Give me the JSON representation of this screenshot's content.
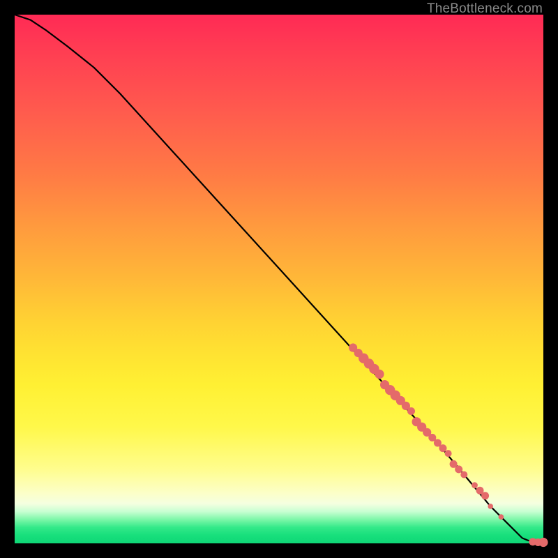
{
  "watermark": "TheBottleneck.com",
  "colors": {
    "background": "#000000",
    "curve": "#000000",
    "dot": "#e46a6a",
    "gradient_stops": [
      "#ff2a55",
      "#ff7a45",
      "#ffd233",
      "#fffd8e",
      "#17df7c"
    ]
  },
  "chart_data": {
    "type": "line",
    "title": "",
    "xlabel": "",
    "ylabel": "",
    "xlim": [
      0,
      100
    ],
    "ylim": [
      0,
      100
    ],
    "grid": false,
    "legend": false,
    "annotations": [
      "TheBottleneck.com"
    ],
    "series": [
      {
        "name": "bottleneck-curve",
        "x": [
          0,
          3,
          6,
          10,
          15,
          20,
          30,
          40,
          50,
          60,
          70,
          80,
          85,
          90,
          93,
          96,
          97,
          98,
          99,
          100
        ],
        "y": [
          100,
          99,
          97,
          94,
          90,
          85,
          74,
          63,
          52,
          41,
          30,
          19,
          13,
          7,
          4,
          1,
          0.6,
          0.3,
          0.2,
          0.2
        ]
      }
    ],
    "scatter_points": [
      {
        "x": 64,
        "y": 37,
        "r": 1.1
      },
      {
        "x": 65,
        "y": 36,
        "r": 1.1
      },
      {
        "x": 66,
        "y": 35,
        "r": 1.3
      },
      {
        "x": 67,
        "y": 34,
        "r": 1.3
      },
      {
        "x": 68,
        "y": 33,
        "r": 1.3
      },
      {
        "x": 69,
        "y": 32,
        "r": 1.2
      },
      {
        "x": 70,
        "y": 30,
        "r": 1.2
      },
      {
        "x": 71,
        "y": 29,
        "r": 1.3
      },
      {
        "x": 72,
        "y": 28,
        "r": 1.3
      },
      {
        "x": 73,
        "y": 27,
        "r": 1.2
      },
      {
        "x": 74,
        "y": 26,
        "r": 1.1
      },
      {
        "x": 75,
        "y": 25,
        "r": 1.0
      },
      {
        "x": 76,
        "y": 23,
        "r": 1.2
      },
      {
        "x": 77,
        "y": 22,
        "r": 1.2
      },
      {
        "x": 78,
        "y": 21,
        "r": 1.1
      },
      {
        "x": 79,
        "y": 20,
        "r": 1.0
      },
      {
        "x": 80,
        "y": 19,
        "r": 1.0
      },
      {
        "x": 81,
        "y": 18,
        "r": 1.0
      },
      {
        "x": 82,
        "y": 17,
        "r": 0.9
      },
      {
        "x": 83,
        "y": 15,
        "r": 1.0
      },
      {
        "x": 84,
        "y": 14,
        "r": 1.0
      },
      {
        "x": 85,
        "y": 13,
        "r": 0.9
      },
      {
        "x": 87,
        "y": 11,
        "r": 0.8
      },
      {
        "x": 88,
        "y": 10,
        "r": 1.0
      },
      {
        "x": 89,
        "y": 9,
        "r": 1.0
      },
      {
        "x": 90,
        "y": 7,
        "r": 0.7
      },
      {
        "x": 92,
        "y": 5,
        "r": 0.7
      },
      {
        "x": 98,
        "y": 0.3,
        "r": 1.0
      },
      {
        "x": 99,
        "y": 0.2,
        "r": 1.0
      },
      {
        "x": 100,
        "y": 0.2,
        "r": 1.2
      }
    ]
  }
}
